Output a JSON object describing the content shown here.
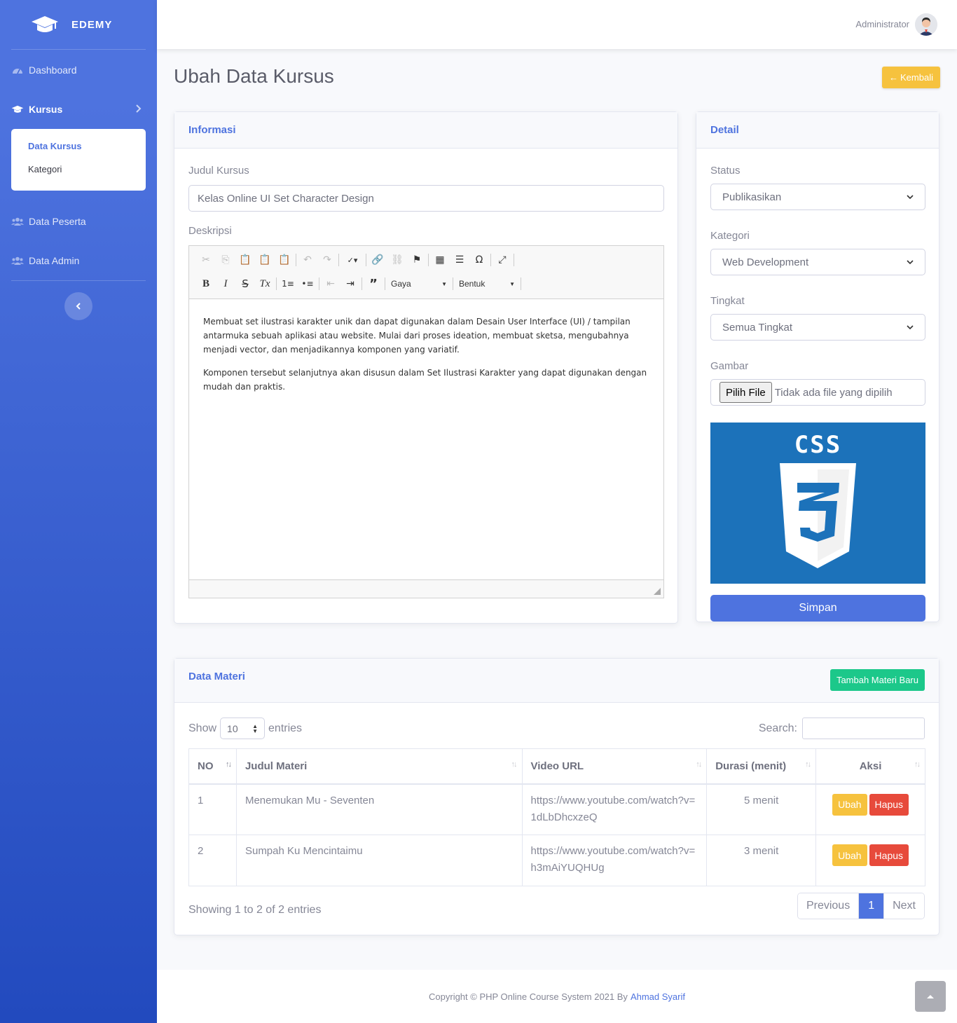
{
  "brand": {
    "name": "EDEMY",
    "icon": "graduation-cap-icon"
  },
  "sidebar": {
    "items": [
      {
        "label": "Dashboard",
        "icon": "tachometer-icon"
      },
      {
        "label": "Kursus",
        "icon": "graduation-cap-icon"
      },
      {
        "label": "Data Peserta",
        "icon": "users-icon"
      },
      {
        "label": "Data Admin",
        "icon": "users-icon"
      }
    ],
    "submenu": [
      "Data Kursus",
      "Kategori"
    ]
  },
  "topbar": {
    "user": "Administrator"
  },
  "page": {
    "title": "Ubah Data Kursus",
    "back_label": "Kembali"
  },
  "info": {
    "header": "Informasi",
    "judul_label": "Judul Kursus",
    "judul_value": "Kelas Online UI Set Character Design",
    "deskripsi_label": "Deskripsi",
    "editor": {
      "style_combo": "Gaya",
      "format_combo": "Bentuk",
      "para1": "Membuat set ilustrasi karakter unik dan dapat digunakan dalam Desain User Interface (UI) / tampilan antarmuka sebuah aplikasi atau website. Mulai dari proses ideation, membuat sketsa, mengubahnya menjadi vector, dan menjadikannya komponen yang variatif.",
      "para2": "Komponen tersebut selanjutnya akan disusun dalam Set Ilustrasi Karakter yang dapat digunakan dengan mudah dan praktis."
    }
  },
  "detail": {
    "header": "Detail",
    "status_label": "Status",
    "status_value": "Publikasikan",
    "kategori_label": "Kategori",
    "kategori_value": "Web Development",
    "tingkat_label": "Tingkat",
    "tingkat_value": "Semua Tingkat",
    "gambar_label": "Gambar",
    "file_button": "Pilih File",
    "file_text": "Tidak ada file yang dipilih",
    "image_text": "CSS",
    "save_label": "Simpan"
  },
  "materi": {
    "header": "Data Materi",
    "add_label": "Tambah Materi Baru",
    "show_label": "Show",
    "entries_value": "10",
    "entries_label": "entries",
    "search_label": "Search:",
    "columns": [
      "NO",
      "Judul Materi",
      "Video URL",
      "Durasi (menit)",
      "Aksi"
    ],
    "rows": [
      {
        "no": "1",
        "judul": "Menemukan Mu - Seventen",
        "url": "https://www.youtube.com/watch?v=1dLbDhcxzeQ",
        "durasi": "5 menit"
      },
      {
        "no": "2",
        "judul": "Sumpah Ku Mencintaimu",
        "url": "https://www.youtube.com/watch?v=h3mAiYUQHUg",
        "durasi": "3 menit"
      }
    ],
    "edit_label": "Ubah",
    "delete_label": "Hapus",
    "info": "Showing 1 to 2 of 2 entries",
    "prev": "Previous",
    "page": "1",
    "next": "Next"
  },
  "footer": {
    "text": "Copyright © PHP Online Course System 2021 By",
    "author": "Ahmad Syarif"
  },
  "colors": {
    "primary": "#4e73df",
    "warning": "#f6c23e",
    "success": "#1cc88a",
    "danger": "#e74a3b",
    "css_blue": "#1c72ba"
  }
}
